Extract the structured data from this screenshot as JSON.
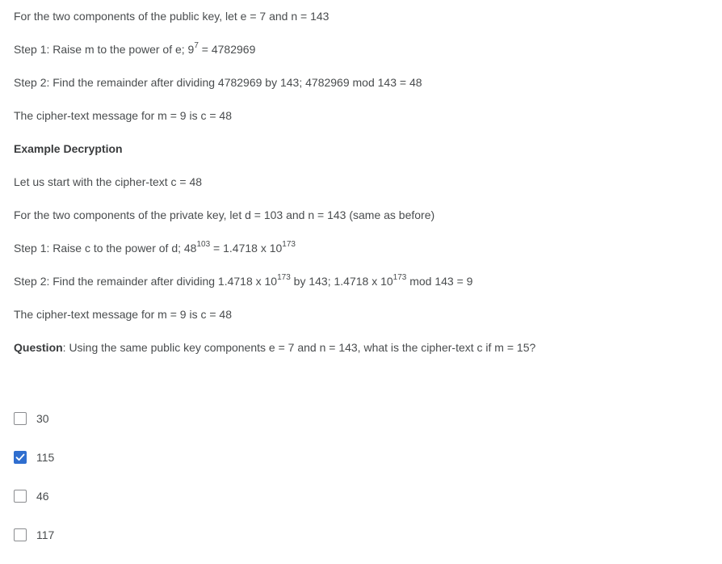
{
  "encryption": {
    "public_key_line": "For the two components of the public key, let e = 7 and n = 143",
    "step1_prefix": "Step 1: Raise m to the power of e; 9",
    "step1_exp": "7",
    "step1_suffix": " = 4782969",
    "step2_line": "Step 2: Find the remainder after dividing 4782969 by 143; 4782969 mod 143 = 48",
    "result_line": "The cipher-text message for m = 9 is c = 48"
  },
  "decryption": {
    "heading": "Example Decryption",
    "start_line": "Let us start with the cipher-text c = 48",
    "private_key_line": "For the two components of the private key, let d = 103 and n = 143 (same as before)",
    "step1_a": "Step 1: Raise c to the power of d; 48",
    "step1_exp1": "103",
    "step1_b": " = 1.4718 x 10",
    "step1_exp2": "173",
    "step2_a": "Step 2: Find the remainder after dividing 1.4718 x 10",
    "step2_exp1": "173",
    "step2_b": " by 143; 1.4718 x 10",
    "step2_exp2": "173",
    "step2_c": " mod 143 = 9",
    "result_line": "The cipher-text message for m = 9 is c = 48"
  },
  "question": {
    "label": "Question",
    "text": ": Using the same public key components e = 7 and n = 143, what is the cipher-text c if m = 15?"
  },
  "options": [
    {
      "label": "30",
      "checked": false
    },
    {
      "label": "115",
      "checked": true
    },
    {
      "label": "46",
      "checked": false
    },
    {
      "label": "117",
      "checked": false
    }
  ],
  "colors": {
    "checkbox_checked": "#2f6ecf",
    "text": "#494c4e"
  }
}
